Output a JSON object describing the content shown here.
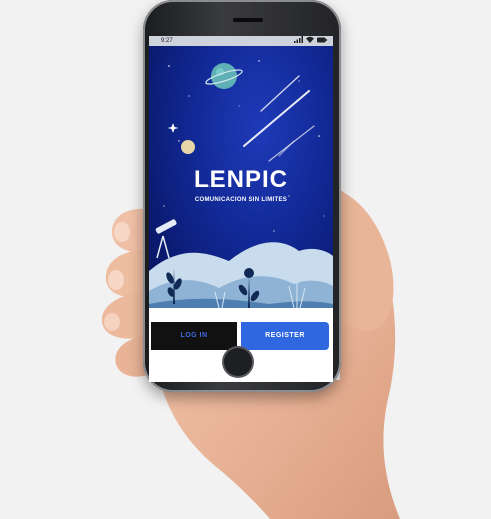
{
  "app": {
    "title": "LENPIC",
    "subtitle": "COMUNICACION SIN LIMITES"
  },
  "status_bar": {
    "time": "9:27"
  },
  "buttons": {
    "login_label": "LOG IN",
    "register_label": "REGISTER"
  },
  "colors": {
    "sky": "#122a98",
    "register": "#2f67e0",
    "login": "#111111"
  }
}
